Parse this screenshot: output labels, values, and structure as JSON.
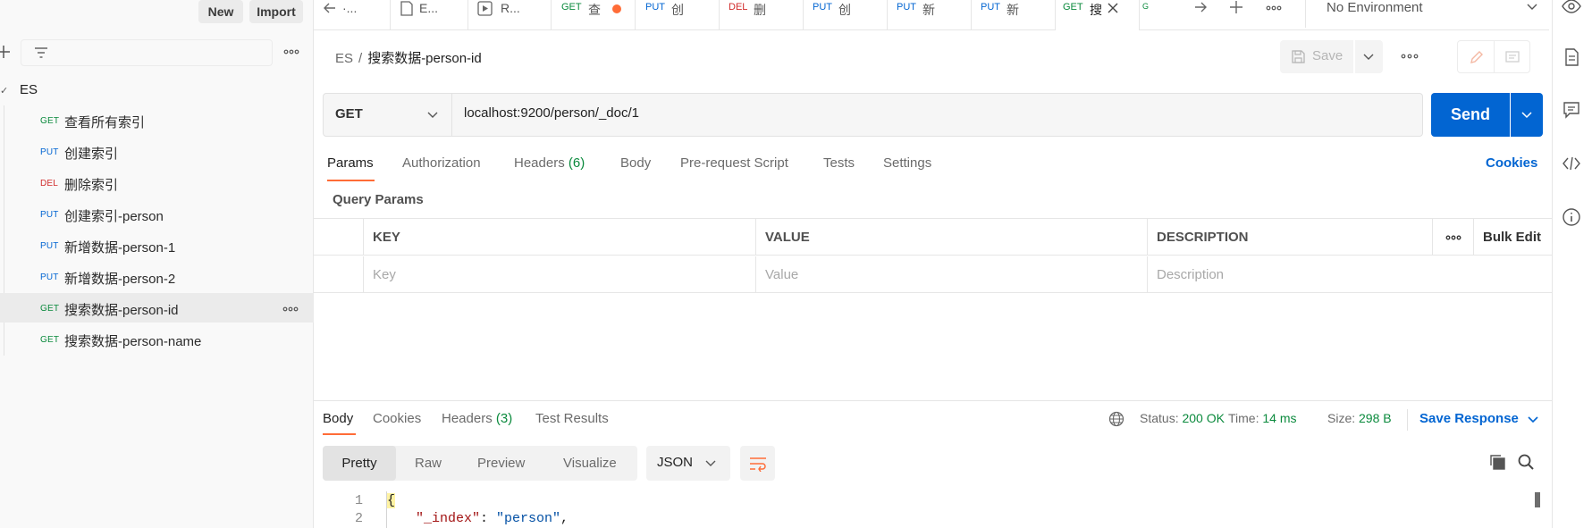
{
  "sidebar": {
    "new_label": "New",
    "import_label": "Import",
    "collection": "ES",
    "requests": [
      {
        "method": "GET",
        "name": "查看所有索引"
      },
      {
        "method": "PUT",
        "name": "创建索引"
      },
      {
        "method": "DEL",
        "name": "删除索引"
      },
      {
        "method": "PUT",
        "name": "创建索引-person"
      },
      {
        "method": "PUT",
        "name": "新增数据-person-1"
      },
      {
        "method": "PUT",
        "name": "新增数据-person-2"
      },
      {
        "method": "GET",
        "name": "搜索数据-person-id"
      },
      {
        "method": "GET",
        "name": "搜索数据-person-name"
      }
    ]
  },
  "tabs": [
    {
      "method": "",
      "name": "·..."
    },
    {
      "method": "",
      "name": "E..."
    },
    {
      "method": "",
      "name": "R..."
    },
    {
      "method": "GET",
      "name": "查"
    },
    {
      "method": "PUT",
      "name": "创"
    },
    {
      "method": "DEL",
      "name": "删"
    },
    {
      "method": "PUT",
      "name": "创"
    },
    {
      "method": "PUT",
      "name": "新"
    },
    {
      "method": "PUT",
      "name": "新"
    },
    {
      "method": "GET",
      "name": "搜"
    },
    {
      "method": "G",
      "name": ""
    }
  ],
  "environment": "No Environment",
  "breadcrumb": {
    "root": "ES",
    "sep": "/",
    "current": "搜索数据-person-id"
  },
  "save_label": "Save",
  "request": {
    "method": "GET",
    "url": "localhost:9200/person/_doc/1",
    "send_label": "Send"
  },
  "req_tabs": {
    "params": "Params",
    "authorization": "Authorization",
    "headers": "Headers",
    "headers_count": "(6)",
    "body": "Body",
    "prerequest": "Pre-request Script",
    "tests": "Tests",
    "settings": "Settings",
    "cookies": "Cookies"
  },
  "query_params": {
    "title": "Query Params",
    "cols": {
      "key": "KEY",
      "value": "VALUE",
      "description": "DESCRIPTION",
      "bulk_edit": "Bulk Edit"
    },
    "placeholders": {
      "key": "Key",
      "value": "Value",
      "description": "Description"
    }
  },
  "response": {
    "tabs": {
      "body": "Body",
      "cookies": "Cookies",
      "headers": "Headers",
      "headers_count": "(3)",
      "tests": "Test Results"
    },
    "status_label": "Status:",
    "status": "200 OK",
    "time_label": "Time:",
    "time": "14 ms",
    "size_label": "Size:",
    "size": "298 B",
    "save_label": "Save Response",
    "views": {
      "pretty": "Pretty",
      "raw": "Raw",
      "preview": "Preview",
      "visualize": "Visualize"
    },
    "format": "JSON",
    "lines": [
      {
        "num": "1",
        "text": "{"
      },
      {
        "num": "2",
        "key": "\"_index\"",
        "colon": ": ",
        "value": "\"person\"",
        "end": ","
      }
    ]
  },
  "colors": {
    "get": "#0b8a3d",
    "put": "#0265d2",
    "del": "#d12c2c",
    "accent": "#ff6c37",
    "primary": "#0265d2"
  }
}
